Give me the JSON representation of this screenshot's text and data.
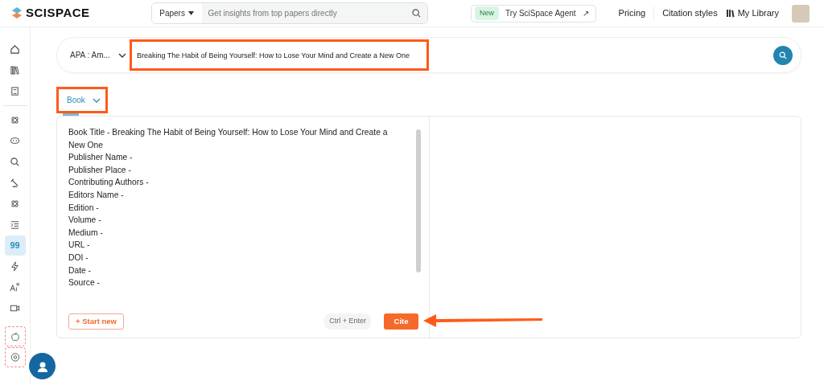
{
  "header": {
    "logo": "SCISPACE",
    "search": {
      "mode": "Papers",
      "placeholder": "Get insights from top papers directly"
    },
    "agent": {
      "badge": "New",
      "label": "Try SciSpace Agent",
      "arrow": "↗"
    },
    "links": [
      "Pricing",
      "Citation styles"
    ],
    "library": "My Library"
  },
  "sidebar": {
    "items": [
      {
        "kind": "home",
        "selected": false
      },
      {
        "kind": "library",
        "selected": false
      },
      {
        "kind": "notebook",
        "selected": false
      },
      {
        "kind": "divider"
      },
      {
        "kind": "atom",
        "selected": false
      },
      {
        "kind": "chat",
        "selected": false
      },
      {
        "kind": "search",
        "selected": false
      },
      {
        "kind": "pen",
        "selected": false
      },
      {
        "kind": "atom",
        "selected": false
      },
      {
        "kind": "indent",
        "selected": false
      },
      {
        "kind": "text",
        "text": "99",
        "selected": true
      },
      {
        "kind": "bolt",
        "selected": false
      },
      {
        "kind": "ai",
        "selected": false
      },
      {
        "kind": "video",
        "selected": false
      },
      {
        "kind": "apple",
        "selected": false
      },
      {
        "kind": "chrome",
        "selected": false
      }
    ]
  },
  "query": {
    "style": "APA : Am...",
    "value": "Breaking The Habit of Being Yourself: How to Lose Your Mind and Create a New One"
  },
  "source_type": "Book",
  "fields": [
    "Book Title - Breaking The Habit of Being Yourself: How to Lose Your Mind and Create a New One",
    "Publisher Name -",
    "Publisher Place -",
    "Contributing Authors -",
    "Editors Name -",
    "Edition -",
    "Volume -",
    "Medium -",
    "URL -",
    "DOI -",
    "Date -",
    "Source -"
  ],
  "actions": {
    "start_new": "+ Start new",
    "shortcut": "Ctrl + Enter",
    "cite": "Cite"
  }
}
